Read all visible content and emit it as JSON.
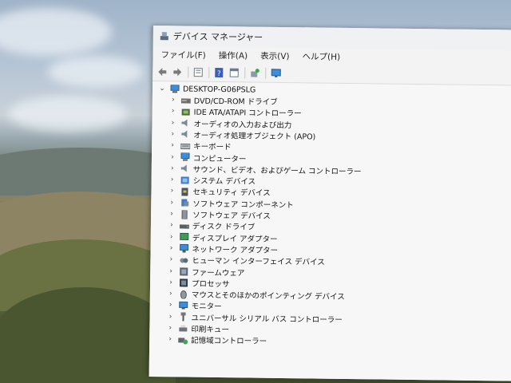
{
  "window": {
    "title": "デバイス マネージャー"
  },
  "menu": [
    {
      "label": "ファイル(F)"
    },
    {
      "label": "操作(A)"
    },
    {
      "label": "表示(V)"
    },
    {
      "label": "ヘルプ(H)"
    }
  ],
  "toolbar_icons": [
    "back-arrow-icon",
    "forward-arrow-icon",
    "properties-icon",
    "help-icon",
    "details-icon",
    "update-driver-icon",
    "monitor-scan-icon"
  ],
  "tree": {
    "root": {
      "label": "DESKTOP-G06PSLG",
      "expanded": true
    },
    "categories": [
      {
        "label": "DVD/CD-ROM ドライブ",
        "icon": "dvd-drive-icon"
      },
      {
        "label": "IDE ATA/ATAPI コントローラー",
        "icon": "ide-controller-icon"
      },
      {
        "label": "オーディオの入力および出力",
        "icon": "speaker-icon"
      },
      {
        "label": "オーディオ処理オブジェクト (APO)",
        "icon": "speaker-icon"
      },
      {
        "label": "キーボード",
        "icon": "keyboard-icon"
      },
      {
        "label": "コンピューター",
        "icon": "computer-icon"
      },
      {
        "label": "サウンド、ビデオ、およびゲーム コントローラー",
        "icon": "speaker-icon"
      },
      {
        "label": "システム デバイス",
        "icon": "system-device-icon"
      },
      {
        "label": "セキュリティ デバイス",
        "icon": "security-device-icon"
      },
      {
        "label": "ソフトウェア コンポーネント",
        "icon": "software-component-icon"
      },
      {
        "label": "ソフトウェア デバイス",
        "icon": "software-device-icon"
      },
      {
        "label": "ディスク ドライブ",
        "icon": "disk-drive-icon"
      },
      {
        "label": "ディスプレイ アダプター",
        "icon": "display-adapter-icon"
      },
      {
        "label": "ネットワーク アダプター",
        "icon": "network-adapter-icon"
      },
      {
        "label": "ヒューマン インターフェイス デバイス",
        "icon": "hid-icon"
      },
      {
        "label": "ファームウェア",
        "icon": "firmware-icon"
      },
      {
        "label": "プロセッサ",
        "icon": "processor-icon"
      },
      {
        "label": "マウスとそのほかのポインティング デバイス",
        "icon": "mouse-icon"
      },
      {
        "label": "モニター",
        "icon": "monitor-icon"
      },
      {
        "label": "ユニバーサル シリアル バス コントローラー",
        "icon": "usb-icon"
      },
      {
        "label": "印刷キュー",
        "icon": "printer-icon"
      },
      {
        "label": "記憶域コントローラー",
        "icon": "storage-controller-icon"
      }
    ]
  }
}
